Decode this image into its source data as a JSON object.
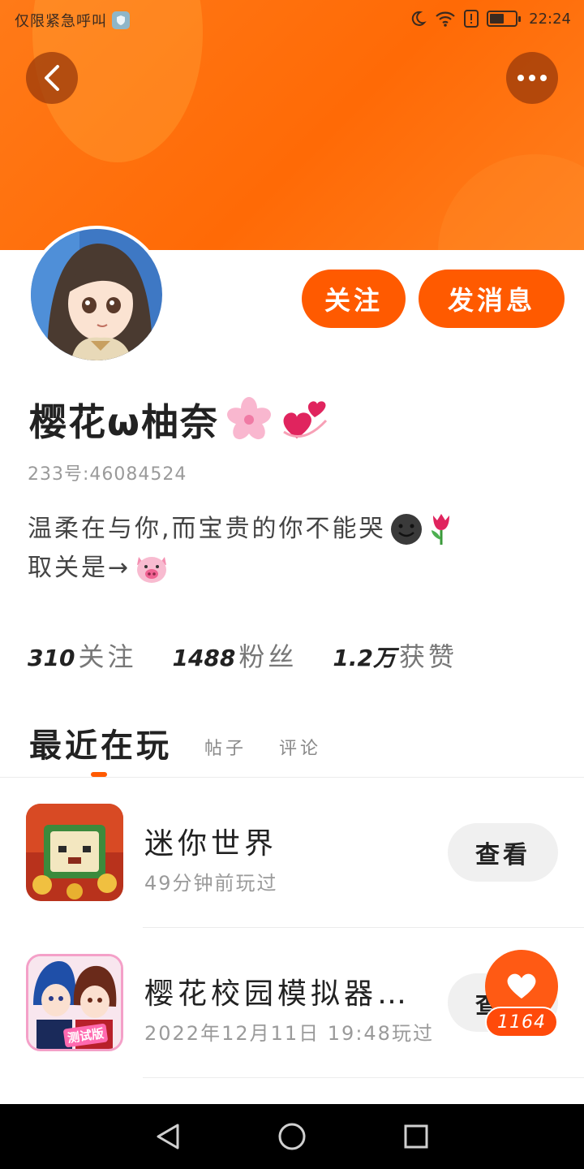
{
  "status_bar": {
    "carrier_text": "仅限紧急呼叫",
    "time": "22:24",
    "battery_level": 0.55,
    "icons": [
      "shield-icon",
      "moon-icon",
      "wifi-icon",
      "alert-icon",
      "battery-icon"
    ]
  },
  "header": {
    "back_icon": "chevron-left-icon",
    "more_icon": "more-dots-icon",
    "accent_color": "#ff6a06"
  },
  "profile": {
    "username": "樱花ω柚奈",
    "username_emojis": [
      "cherry-blossom",
      "revolving-hearts"
    ],
    "uid": "233号:46084524",
    "bio_line1": "温柔在与你,而宝贵的你不能哭",
    "bio_line1_emojis": [
      "smiling-face",
      "tulip"
    ],
    "bio_line2": "取关是→",
    "bio_line2_emoji": "pig-face",
    "follow_label": "关注",
    "message_label": "发消息"
  },
  "stats": [
    {
      "value": "310",
      "label": "关注"
    },
    {
      "value": "1488",
      "label": "粉丝"
    },
    {
      "value": "1.2万",
      "label": "获赞"
    }
  ],
  "tabs": {
    "active": "最近在玩",
    "others": [
      "帖子",
      "评论"
    ]
  },
  "games": [
    {
      "title": "迷你世界",
      "subtitle": "49分钟前玩过",
      "button": "查看",
      "icon": "mini-world-icon"
    },
    {
      "title": "樱花校园模拟器…",
      "subtitle": "2022年12月11日 19:48玩过",
      "button": "查看",
      "icon": "sakura-school-icon",
      "icon_badge": "测试版"
    }
  ],
  "like": {
    "count": "1164",
    "icon": "heart-icon"
  },
  "nav": {
    "icons": [
      "back-triangle-icon",
      "home-circle-icon",
      "recents-square-icon"
    ]
  }
}
